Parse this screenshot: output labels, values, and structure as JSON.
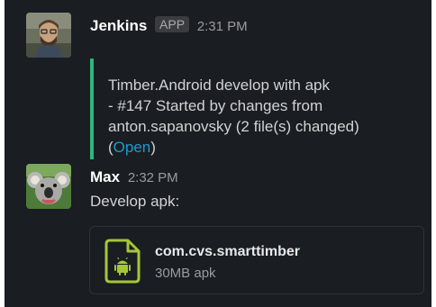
{
  "messages": [
    {
      "author": "Jenkins",
      "badge": "APP",
      "time": "2:31 PM",
      "attachment": {
        "line1": "Timber.Android develop with apk",
        "line2": "- #147 Started by changes from",
        "line3": "anton.sapanovsky (2 file(s) changed)",
        "link_open_paren": "(",
        "link_text": "Open",
        "link_close_paren": ")",
        "accent_color": "#2eb67d"
      }
    },
    {
      "author": "Max",
      "time": "2:32 PM",
      "text": "Develop apk:",
      "file": {
        "name": "com.cvs.smarttimber",
        "meta": "30MB apk",
        "icon": "android-file-icon",
        "icon_color": "#a4c639"
      }
    }
  ],
  "colors": {
    "background": "#1a1d21",
    "link": "#1d9bd1"
  }
}
